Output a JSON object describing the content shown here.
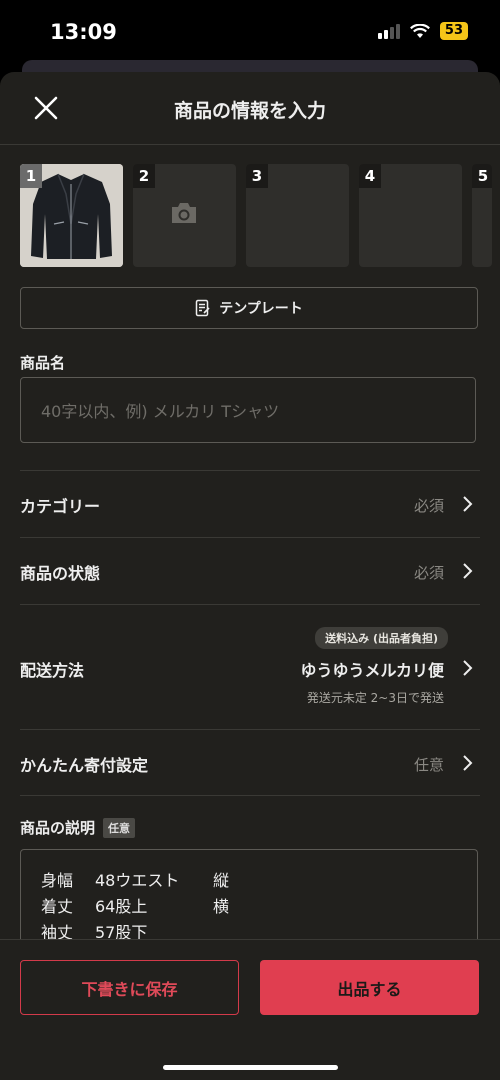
{
  "status": {
    "time": "13:09",
    "battery": "53"
  },
  "header": {
    "title": "商品の情報を入力"
  },
  "photos": [
    "1",
    "2",
    "3",
    "4",
    "5"
  ],
  "template": {
    "label": "テンプレート"
  },
  "product_name": {
    "label": "商品名",
    "placeholder": "40字以内、例) メルカリ Tシャツ"
  },
  "rows": {
    "category": {
      "label": "カテゴリー",
      "value": "必須"
    },
    "condition": {
      "label": "商品の状態",
      "value": "必須"
    },
    "shipping": {
      "label": "配送方法",
      "badge": "送料込み (出品者負担)",
      "value": "ゆうゆうメルカリ便",
      "note": "発送元未定 2~3日で発送"
    },
    "donation": {
      "label": "かんたん寄付設定",
      "value": "任意"
    }
  },
  "description": {
    "label": "商品の説明",
    "tag": "任意",
    "lines": [
      [
        "身幅",
        "48ウエスト",
        "縦"
      ],
      [
        "着丈",
        "64股上",
        "横"
      ],
      [
        "袖丈",
        "57股下",
        ""
      ]
    ]
  },
  "actions": {
    "draft": "下書きに保存",
    "submit": "出品する"
  },
  "colors": {
    "accent": "#e03e50",
    "sheet": "#21201d",
    "battery": "#f5c518"
  }
}
